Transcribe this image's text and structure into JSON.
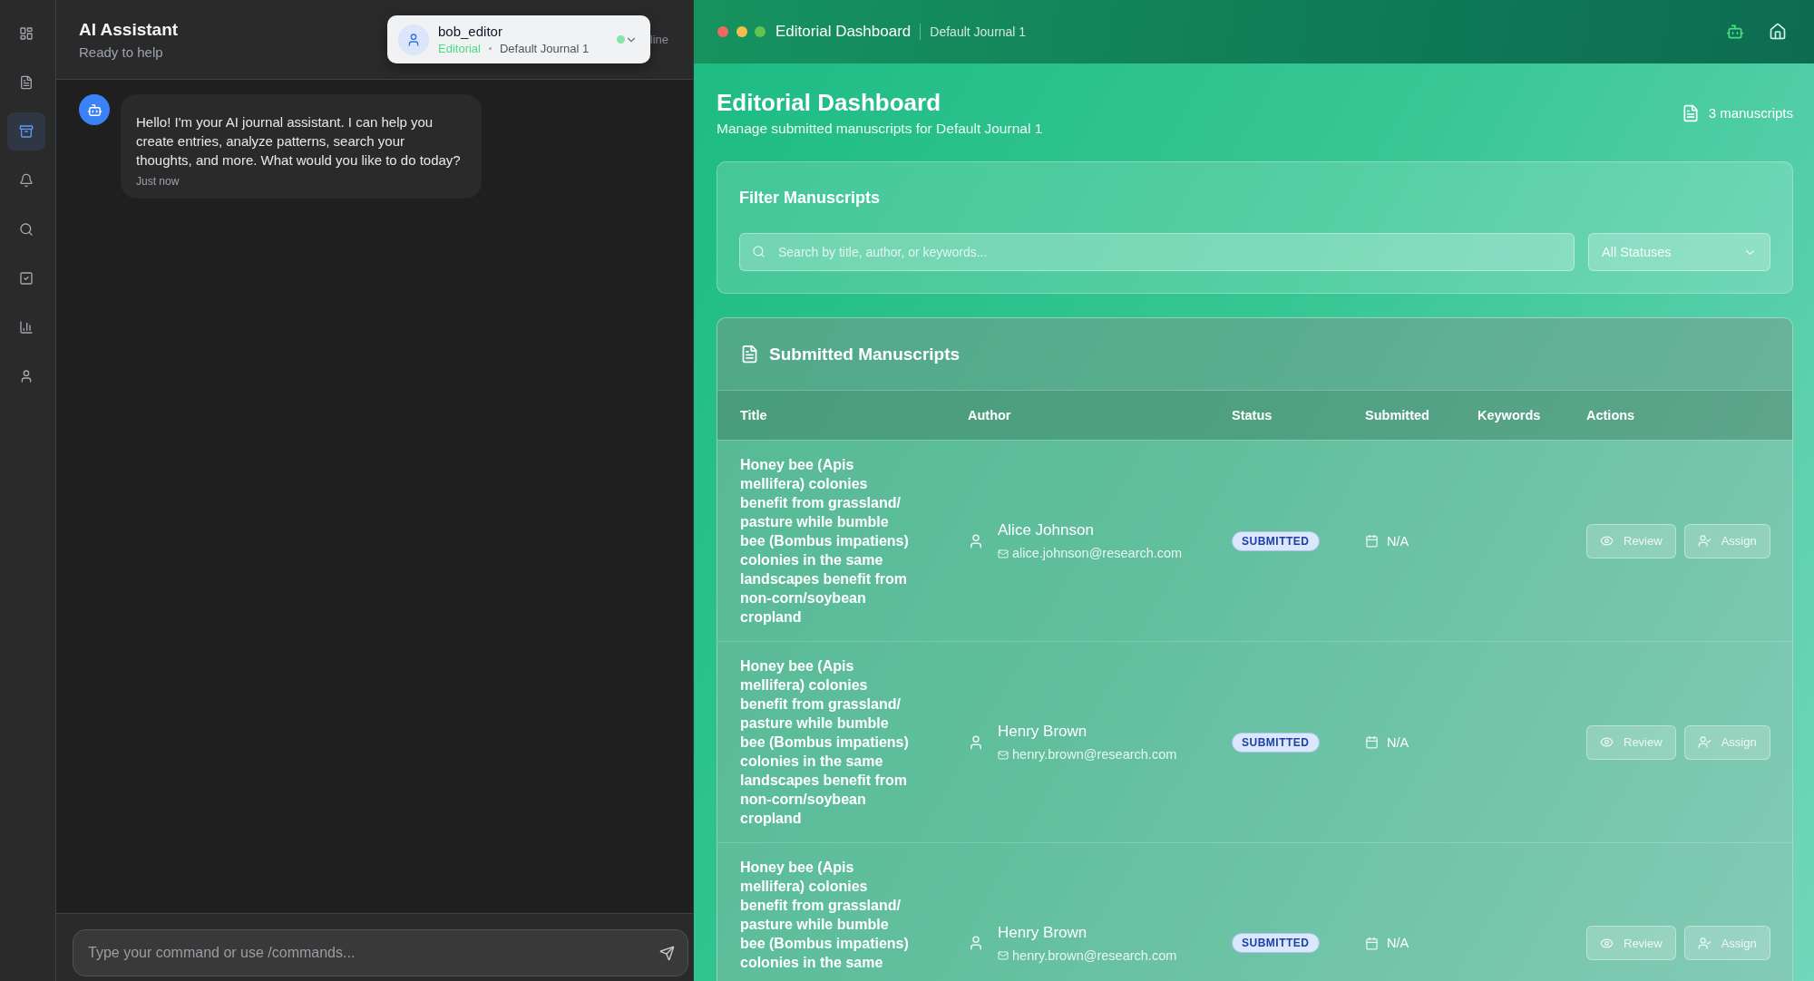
{
  "sidebar": {
    "items": [
      {
        "selected": false
      },
      {
        "selected": false
      },
      {
        "selected": true
      },
      {
        "selected": false
      },
      {
        "selected": false
      },
      {
        "selected": false
      },
      {
        "selected": false
      },
      {
        "selected": false
      }
    ]
  },
  "assistant": {
    "title": "AI Assistant",
    "subtitle": "Ready to help",
    "status": "line",
    "user_card": {
      "username": "bob_editor",
      "role": "Editorial",
      "journal": "Default Journal 1",
      "online": true
    },
    "messages": [
      {
        "kind": "assistant",
        "text": "Hello! I'm your AI journal assistant. I can help you create entries, analyze patterns, search your thoughts, and more. What would you like to do today?",
        "time": "Just now"
      }
    ],
    "input": {
      "placeholder": "Type your command or use /commands..."
    }
  },
  "window": {
    "title": "Editorial Dashboard",
    "subtitle": "Default Journal 1",
    "toolbar": [
      {
        "selected": true
      },
      {
        "selected": false
      }
    ]
  },
  "dashboard": {
    "title": "Editorial Dashboard",
    "subtitle": "Manage submitted manuscripts for Default Journal 1",
    "count": "3 manuscripts",
    "filter": {
      "title": "Filter Manuscripts",
      "search": {
        "placeholder": "Search by title, author, or keywords..."
      },
      "status_select": {
        "value": "All Statuses"
      }
    },
    "table": {
      "title": "Submitted Manuscripts",
      "columns": [
        "Title",
        "Author",
        "Status",
        "Submitted",
        "Keywords",
        "Actions"
      ],
      "rows": [
        {
          "title": "Honey bee (Apis mellifera) colonies benefit from grassland/pasture while bumble bee (Bombus impatiens) colonies in the same landscapes benefit from non-corn/soybean cropland",
          "author": "Alice Johnson",
          "email": "alice.johnson@research.com",
          "status": "SUBMITTED",
          "submitted": "N/A",
          "actions": [
            "Review",
            "Assign"
          ]
        },
        {
          "title": "Honey bee (Apis mellifera) colonies benefit from grassland/pasture while bumble bee (Bombus impatiens) colonies in the same landscapes benefit from non-corn/soybean cropland",
          "author": "Henry Brown",
          "email": "henry.brown@research.com",
          "status": "SUBMITTED",
          "submitted": "N/A",
          "actions": [
            "Review",
            "Assign"
          ]
        },
        {
          "title": "Honey bee (Apis mellifera) colonies benefit from grassland/pasture while bumble bee (Bombus impatiens) colonies in the same",
          "author": "Henry Brown",
          "email": "henry.brown@research.com",
          "status": "SUBMITTED",
          "submitted": "N/A",
          "actions": [
            "Review",
            "Assign"
          ]
        }
      ]
    }
  }
}
